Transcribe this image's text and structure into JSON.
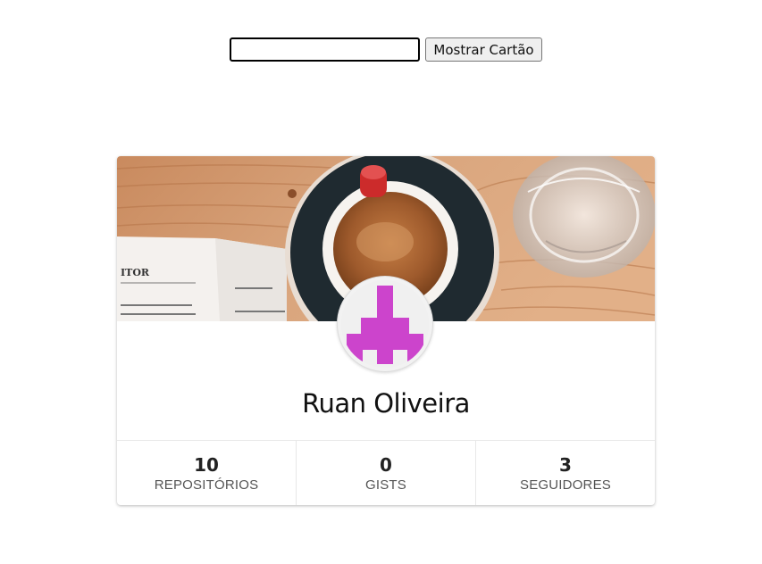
{
  "search": {
    "value": "",
    "button_label": "Mostrar Cartão"
  },
  "profile": {
    "name": "Ruan Oliveira",
    "avatar_color": "#cc44cc",
    "cover_icon": "coffee-cup-cover-photo"
  },
  "stats": [
    {
      "value": "10",
      "label": "REPOSITÓRIOS"
    },
    {
      "value": "0",
      "label": "GISTS"
    },
    {
      "value": "3",
      "label": "SEGUIDORES"
    }
  ]
}
